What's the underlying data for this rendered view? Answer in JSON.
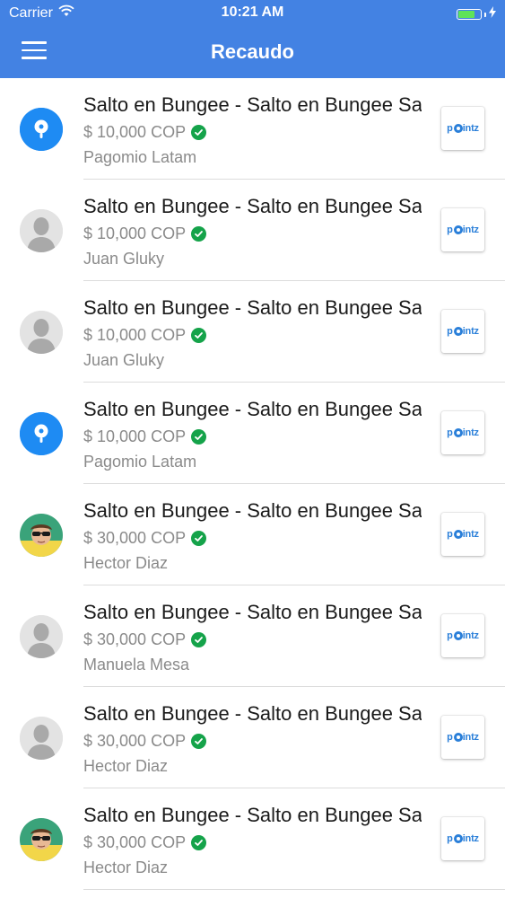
{
  "status_bar": {
    "carrier": "Carrier",
    "time": "10:21 AM",
    "wifi_icon": "wifi-icon",
    "battery_level": 0.75,
    "battery_color": "#5fe35a"
  },
  "nav": {
    "title": "Recaudo",
    "menu_icon": "hamburger-menu-icon",
    "color": "#4382e3"
  },
  "items": [
    {
      "title": "Salto en Bungee - Salto en Bungee Salto en Bungee",
      "price": "$ 10,000 COP",
      "payer": "Pagomio Latam",
      "avatar": "brand",
      "logo": "pointz"
    },
    {
      "title": "Salto en Bungee - Salto en Bungee Salto en Bungee",
      "price": "$ 10,000 COP",
      "payer": "Juan Gluky",
      "avatar": "default",
      "logo": "pointz"
    },
    {
      "title": "Salto en Bungee - Salto en Bungee Salto en Bungee",
      "price": "$ 10,000 COP",
      "payer": "Juan Gluky",
      "avatar": "default",
      "logo": "pointz"
    },
    {
      "title": "Salto en Bungee - Salto en Bungee Salto en Bungee",
      "price": "$ 10,000 COP",
      "payer": "Pagomio Latam",
      "avatar": "brand",
      "logo": "pointz"
    },
    {
      "title": "Salto en Bungee - Salto en Bungee Salto en Bungee",
      "price": "$ 30,000 COP",
      "payer": "Hector Diaz",
      "avatar": "photo",
      "logo": "pointz"
    },
    {
      "title": "Salto en Bungee - Salto en Bungee Salto en Bungee",
      "price": "$ 30,000 COP",
      "payer": "Manuela Mesa",
      "avatar": "default",
      "logo": "pointz"
    },
    {
      "title": "Salto en Bungee - Salto en Bungee Salto en Bungee",
      "price": "$ 30,000 COP",
      "payer": "Hector Diaz",
      "avatar": "default",
      "logo": "pointz"
    },
    {
      "title": "Salto en Bungee - Salto en Bungee Salto en Bungee",
      "price": "$ 30,000 COP",
      "payer": "Hector Diaz",
      "avatar": "photo",
      "logo": "pointz"
    }
  ],
  "verified_icon": "check-circle-icon",
  "logo_text": {
    "pre": "p",
    "post": "intz"
  }
}
